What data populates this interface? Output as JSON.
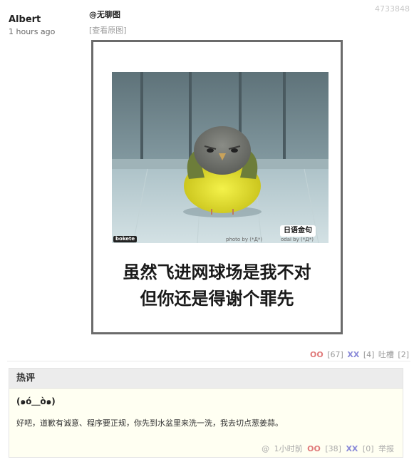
{
  "post": {
    "id": "4733848",
    "author": "Albert",
    "time": "1 hours ago",
    "title": "@无聊图",
    "view_original": "[查看原图]"
  },
  "meme": {
    "caption_line1": "虽然飞进网球场是我不对",
    "caption_line2": "但你还是得谢个罪先",
    "watermark": "日语金句",
    "brand": "bokete",
    "credit_photo": "photo by (*Д*)",
    "credit_odai": "odai by (*Д*)"
  },
  "votes": {
    "oo_label": "OO",
    "oo_count": "[67]",
    "xx_label": "XX",
    "xx_count": "[4]",
    "tucao_label": "吐槽",
    "tucao_count": "[2]"
  },
  "hot_comments": {
    "header": "热评",
    "comment": {
      "user": "(๑ó＿ò๑)",
      "text": "好吧，道歉有诚意、程序要正规，你先到水盆里来洗一洗，我去切点葱姜蒜。",
      "at": "@",
      "time": "1小时前",
      "oo_label": "OO",
      "oo_count": "[38]",
      "xx_label": "XX",
      "xx_count": "[0]",
      "report": "举报"
    }
  },
  "colors": {
    "oo": "#e07a7a",
    "xx": "#8a8ad8",
    "hot_bg": "#fffff2"
  }
}
